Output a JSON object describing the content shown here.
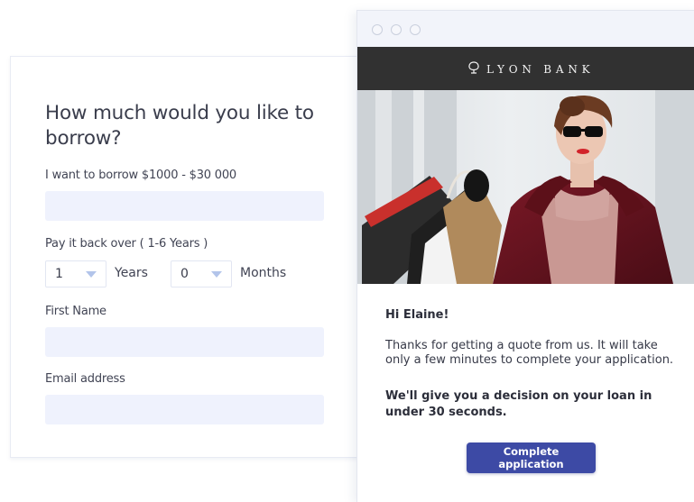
{
  "form": {
    "title": "How much would you like to borrow?",
    "amount_label": "I want to borrow $1000 - $30 000",
    "amount_value": "",
    "payback_label": "Pay it back over ( 1-6 Years )",
    "years_value": "1",
    "years_label": "Years",
    "months_value": "0",
    "months_label": "Months",
    "first_name_label": "First Name",
    "first_name_value": "",
    "email_label": "Email address",
    "email_value": ""
  },
  "email": {
    "bank_name": "LYON BANK",
    "greeting": "Hi Elaine!",
    "message": "Thanks for getting a quote from us. It will take only a few minutes to complete your application.",
    "decision_message": "We'll give you a decision on your loan in under 30 seconds.",
    "cta_label": "Complete application"
  },
  "colors": {
    "brand_bar": "#313131",
    "cta": "#3d4aa5",
    "input_bg": "#eff2fd"
  }
}
